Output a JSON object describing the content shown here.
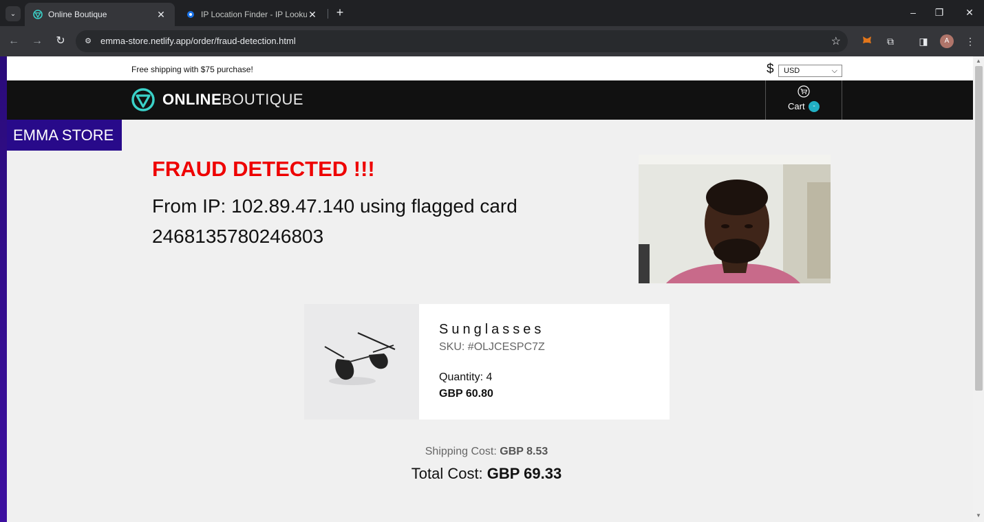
{
  "browser": {
    "tabs": [
      {
        "title": "Online Boutique",
        "active": true
      },
      {
        "title": "IP Location Finder - IP Lookup \\",
        "active": false
      }
    ],
    "close_glyph": "✕",
    "new_tab_glyph": "+",
    "url": "emma-store.netlify.app/order/fraud-detection.html",
    "profile_initial": "A",
    "colors": {
      "chrome_dark": "#202124",
      "chrome_toolbar": "#35363a",
      "omnibox": "#282a2d"
    }
  },
  "page": {
    "topbar": {
      "free_shipping": "Free shipping with $75 purchase!",
      "currency_symbol": "$",
      "currency_value": "USD"
    },
    "header": {
      "logo_bold": "ONLINE",
      "logo_thin": "BOUTIQUE",
      "cart_label": "Cart",
      "cart_badge": "-"
    },
    "store_badge": "EMMA STORE",
    "fraud": {
      "title": "FRAUD DETECTED !!!",
      "message": "From IP: 102.89.47.140 using flagged card 2468135780246803"
    },
    "product": {
      "name": "Sunglasses",
      "sku": "SKU: #OLJCESPC7Z",
      "quantity": "Quantity: 4",
      "price": "GBP 60.80"
    },
    "summary": {
      "shipping_label": "Shipping Cost:",
      "shipping_value": "GBP 8.53",
      "total_label": "Total Cost:",
      "total_value": "GBP 69.33"
    },
    "colors": {
      "fraud_red": "#ee0000",
      "store_badge_bg": "#280a8a",
      "header_bg": "#111111",
      "accent_teal": "#21b0c4",
      "page_bg": "#f0f0f0"
    }
  }
}
